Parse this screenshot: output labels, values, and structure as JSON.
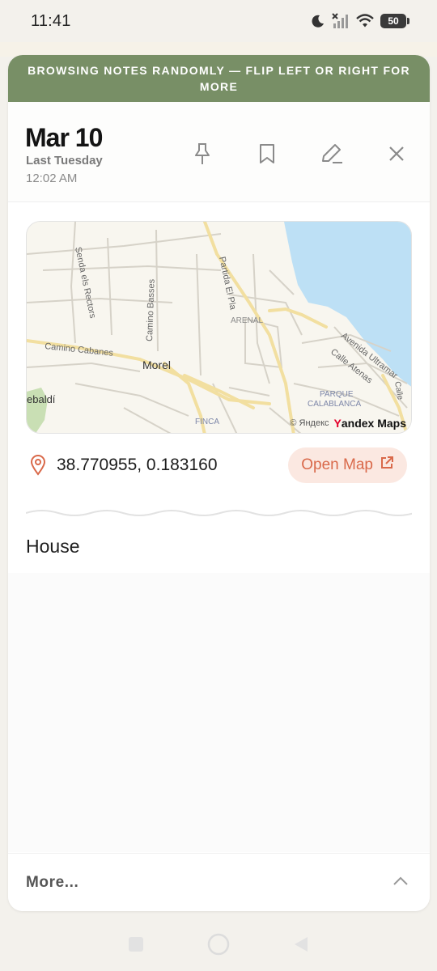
{
  "status_bar": {
    "time": "11:41",
    "battery": "50"
  },
  "banner": {
    "text": "BROWSING NOTES RANDOMLY — FLIP LEFT OR RIGHT FOR MORE"
  },
  "note": {
    "date": "Mar 10",
    "relative": "Last Tuesday",
    "time": "12:02 AM",
    "body": "House"
  },
  "map": {
    "labels": [
      "Senda els Rectors",
      "Camino Basses",
      "Partida El Pla",
      "ARENAL",
      "Camino Cabanes",
      "Morel",
      "Avenida Ultramar",
      "Calle Atenas",
      "PARQUE",
      "CALABLANCA",
      "FINCA",
      "ebaldí",
      "Calle"
    ],
    "attribution": "© Яндекс",
    "logo_prefix": "Y",
    "logo_rest": "andex Maps"
  },
  "location": {
    "coordinates": "38.770955, 0.183160",
    "open_map_label": "Open Map"
  },
  "footer": {
    "more_label": "More..."
  },
  "colors": {
    "banner": "#788f66",
    "accent": "#d9694a",
    "accent_bg": "#fbe8e1",
    "water": "#bde0f5"
  },
  "icons": [
    "moon-icon",
    "signal-icon",
    "wifi-icon",
    "battery-icon",
    "pin-icon",
    "bookmark-icon",
    "edit-icon",
    "close-icon",
    "location-pin-icon",
    "external-link-icon",
    "chevron-up-icon",
    "nav-recents-icon",
    "nav-home-icon",
    "nav-back-icon"
  ]
}
